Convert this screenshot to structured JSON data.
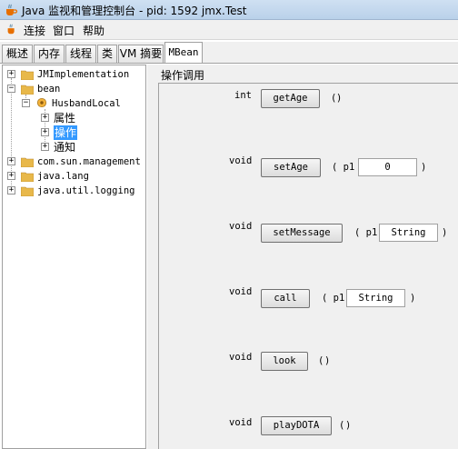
{
  "window": {
    "title": "Java 监视和管理控制台 - pid: 1592 jmx.Test"
  },
  "menubar": {
    "items": [
      "连接",
      "窗口",
      "帮助"
    ]
  },
  "tabs": [
    {
      "label": "概述"
    },
    {
      "label": "内存"
    },
    {
      "label": "线程"
    },
    {
      "label": "类"
    },
    {
      "label": "VM 摘要"
    },
    {
      "label": "MBean",
      "active": true
    }
  ],
  "tree": {
    "jmimpl": "JMImplementation",
    "bean": "bean",
    "husband": "HusbandLocal",
    "attrs": "属性",
    "ops": "操作",
    "notify": "通知",
    "com_sun": "com.sun.management",
    "java_lang": "java.lang",
    "java_util_logging": "java.util.logging"
  },
  "panel": {
    "title": "操作调用"
  },
  "operations": [
    {
      "return_type": "int",
      "name": "getAge",
      "open": "(",
      "close": ")"
    },
    {
      "return_type": "void",
      "name": "setAge",
      "open": "( p1",
      "param_value": "0",
      "close": ")"
    },
    {
      "return_type": "void",
      "name": "setMessage",
      "open": "( p1",
      "param_value": "String",
      "close": ")"
    },
    {
      "return_type": "void",
      "name": "call",
      "open": "( p1",
      "param_value": "String",
      "close": ")"
    },
    {
      "return_type": "void",
      "name": "look",
      "open": "(",
      "close": ")"
    },
    {
      "return_type": "void",
      "name": "playDOTA",
      "open": "(",
      "close": ")"
    }
  ]
}
